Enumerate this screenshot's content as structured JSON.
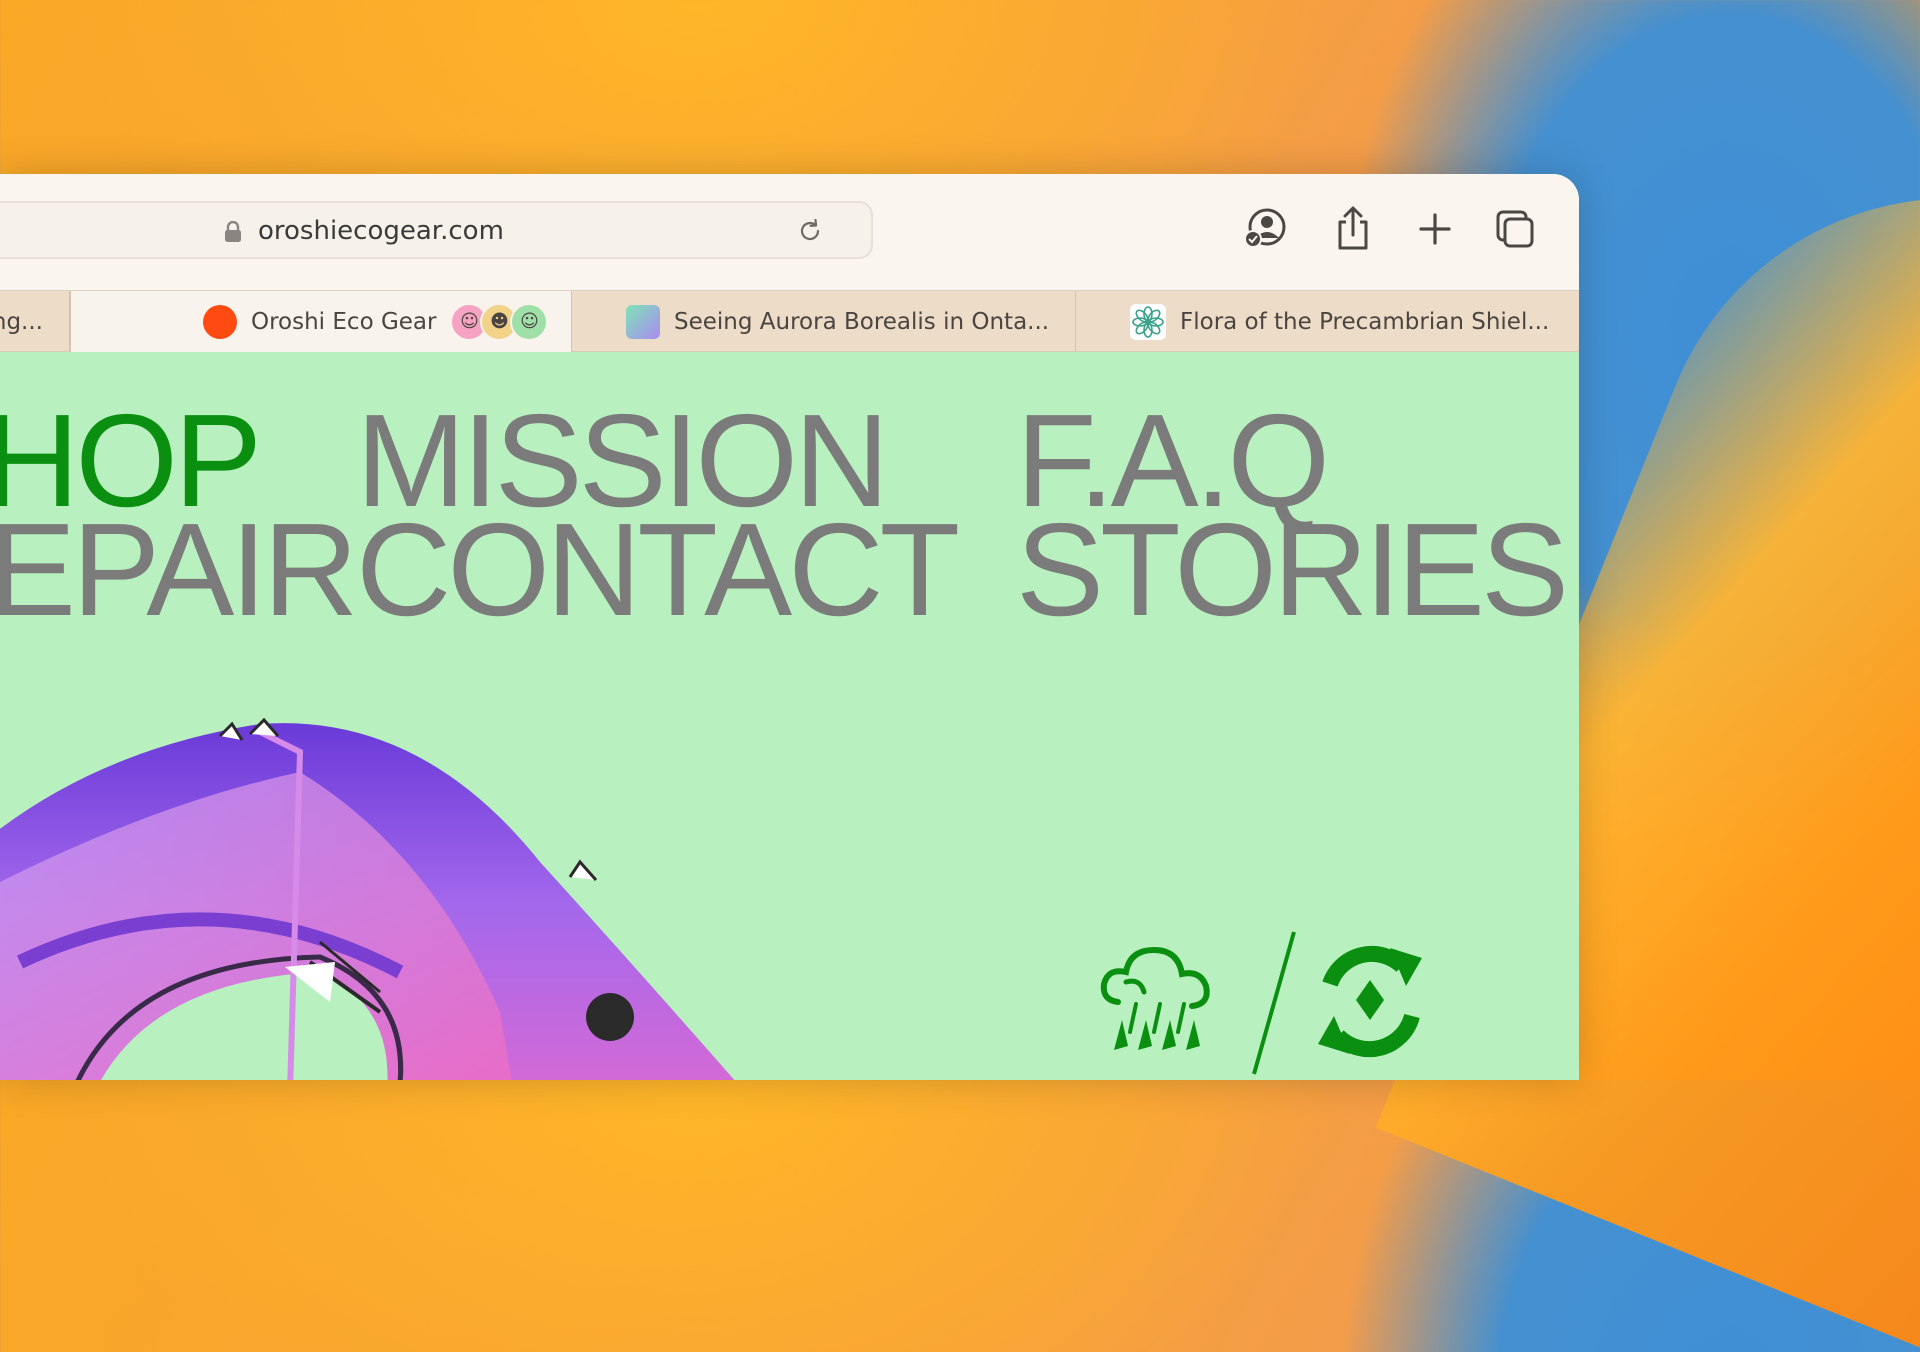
{
  "browser": {
    "url": "oroshiecogear.com",
    "tabs": [
      {
        "label": "ng...",
        "favicon": "none"
      },
      {
        "label": "Oroshi Eco Gear",
        "favicon": "orange-dot",
        "active": true
      },
      {
        "label": "Seeing Aurora Borealis in Onta...",
        "favicon": "aurora-gradient"
      },
      {
        "label": "Flora of the Precambrian Shiel...",
        "favicon": "flower"
      }
    ],
    "toolbar_icons": [
      "shared-profile-icon",
      "share-icon",
      "new-tab-icon",
      "tab-overview-icon"
    ]
  },
  "site": {
    "nav": {
      "shop": "HOP",
      "mission": "MISSION",
      "faq": "F.A.Q",
      "repair": "EPAIR",
      "contact": "CONTACT",
      "stories": "STORIES"
    },
    "colors": {
      "background": "#b8f0bf",
      "active_nav": "#0b8f10",
      "nav": "#7b7b7b"
    },
    "feature_icons": [
      "rain-icon",
      "recycle-icon"
    ]
  }
}
